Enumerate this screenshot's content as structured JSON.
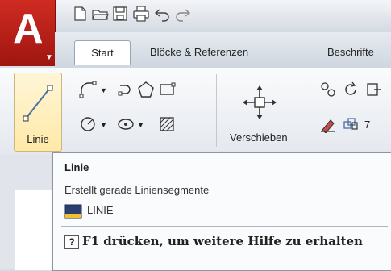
{
  "app": {
    "logo_letter": "A"
  },
  "tabs": [
    {
      "label": "Start"
    },
    {
      "label": "Blöcke & Referenzen"
    },
    {
      "label": "Beschrifte"
    }
  ],
  "ribbon": {
    "linie_label": "Linie",
    "verschieben_label": "Verschieben"
  },
  "tooltip": {
    "title": "Linie",
    "description": "Erstellt gerade Liniensegmente",
    "command": "LINIE",
    "help_icon": "?",
    "help_text": "F1 drücken, um weitere Hilfe zu erhalten"
  }
}
